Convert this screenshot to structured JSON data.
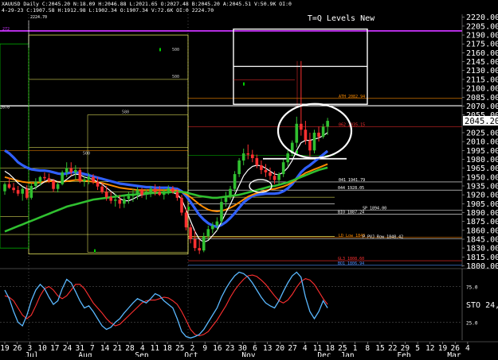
{
  "window": {
    "ticker_line": "XAUUSD Daily C:2045.20 N:18.09 H:2046.88 L:2021.65 O:2027.48 B:2045.20 A:2045.51 V:50.9K OI:0",
    "sub_line": "4-29-23 C:1907.58 H:1912.98 L:1902.34 O:1907.34 V:72.6K OI:0 2224.70",
    "tq_title": "T=Q Levels New"
  },
  "chart_data": [
    {
      "type": "candlestick",
      "title": "XAUUSD Daily",
      "annotation": "T=Q Levels New",
      "y_axis_side": "right",
      "ylim": [
        1798,
        2225
      ],
      "yticks": [
        2220,
        2205,
        2190,
        2175,
        2160,
        2145,
        2130,
        2115,
        2100,
        2085,
        2070,
        2055,
        2025,
        2010,
        1995,
        1980,
        1965,
        1950,
        1935,
        1920,
        1905,
        1890,
        1875,
        1860,
        1845,
        1830,
        1815,
        1800
      ],
      "last_price": "2045.20",
      "x_ticks": [
        "19",
        "26",
        "3",
        "10",
        "17",
        "24",
        "31",
        "7",
        "14",
        "21",
        "28",
        "4",
        "11",
        "18",
        "25",
        "2",
        "9",
        "16",
        "23",
        "30",
        "6",
        "13",
        "20",
        "27",
        "4",
        "11",
        "18",
        "25",
        "1",
        "8",
        "15",
        "22",
        "29",
        "5",
        "12",
        "19",
        "26",
        "4"
      ],
      "months": [
        "Jul",
        "Aug",
        "Sep",
        "Oct",
        "Nov",
        "Dec",
        "Jan",
        "Feb",
        "Mar"
      ],
      "levels": [
        {
          "label": "272",
          "value": 2197,
          "color": "#cc33ff"
        },
        {
          "label": "ATH 2082.94",
          "value": 2082.9,
          "color": "#ff8c00"
        },
        {
          "label": "062 2035.15",
          "value": 2035.15,
          "color": "#ff3030"
        },
        {
          "label": "",
          "value": 2070.5,
          "color": "#ffffff"
        },
        {
          "label": "",
          "value": 1981,
          "color": "#ffffff"
        },
        {
          "label": "",
          "value": 1987,
          "color": "#00c000"
        },
        {
          "label": "041 1941.79",
          "value": 1941.79,
          "color": "#ffffff"
        },
        {
          "label": "044 1928.05",
          "value": 1928.05,
          "color": "#ffffff"
        },
        {
          "label": "SP 1894.00",
          "value": 1894,
          "color": "#ffffff"
        },
        {
          "label": "BIO 1887.24",
          "value": 1887.24,
          "color": "#ffffff"
        },
        {
          "label": "LD Low 1848",
          "value": 1848,
          "color": "#ff8c00"
        },
        {
          "label": "P PVJ Row 1848.42",
          "value": 1846,
          "color": "#ffffff"
        },
        {
          "label": "GL3 1808.60",
          "value": 1808.6,
          "color": "#ff3030"
        },
        {
          "label": "BO1 1806.94",
          "value": 1801,
          "color": "#5090ff"
        }
      ],
      "boxes": [
        {
          "label": "500",
          "top": 2190,
          "bottom": 1820,
          "color": "#ffff66"
        },
        {
          "label": "580",
          "top": 2055,
          "bottom": 1823,
          "color": "#ffff66"
        }
      ],
      "target_box": {
        "top": 2200,
        "mid": 2137,
        "bottom": 2073,
        "color": "#ffffff"
      },
      "candles": [
        [
          1926,
          1941,
          1920,
          1938
        ],
        [
          1938,
          1949,
          1930,
          1932
        ],
        [
          1932,
          1940,
          1923,
          1928
        ],
        [
          1928,
          1935,
          1918,
          1922
        ],
        [
          1922,
          1934,
          1910,
          1930
        ],
        [
          1930,
          1936,
          1912,
          1915
        ],
        [
          1915,
          1940,
          1912,
          1935
        ],
        [
          1935,
          1948,
          1928,
          1942
        ],
        [
          1942,
          1952,
          1935,
          1950
        ],
        [
          1950,
          1958,
          1944,
          1948
        ],
        [
          1948,
          1956,
          1940,
          1944
        ],
        [
          1944,
          1947,
          1925,
          1930
        ],
        [
          1930,
          1942,
          1924,
          1938
        ],
        [
          1938,
          1961,
          1936,
          1958
        ],
        [
          1958,
          1975,
          1950,
          1965
        ],
        [
          1965,
          1975,
          1952,
          1958
        ],
        [
          1958,
          1970,
          1945,
          1962
        ],
        [
          1962,
          1966,
          1940,
          1943
        ],
        [
          1943,
          1952,
          1934,
          1946
        ],
        [
          1946,
          1957,
          1938,
          1950
        ],
        [
          1950,
          1955,
          1938,
          1942
        ],
        [
          1942,
          1950,
          1928,
          1934
        ],
        [
          1934,
          1940,
          1922,
          1925
        ],
        [
          1925,
          1935,
          1910,
          1916
        ],
        [
          1916,
          1925,
          1905,
          1910
        ],
        [
          1910,
          1922,
          1900,
          1912
        ],
        [
          1912,
          1920,
          1897,
          1905
        ],
        [
          1905,
          1918,
          1898,
          1913
        ],
        [
          1913,
          1925,
          1905,
          1918
        ],
        [
          1918,
          1930,
          1908,
          1922
        ],
        [
          1922,
          1933,
          1912,
          1928
        ],
        [
          1928,
          1932,
          1915,
          1920
        ],
        [
          1920,
          1929,
          1912,
          1925
        ],
        [
          1925,
          1935,
          1916,
          1930
        ],
        [
          1930,
          1938,
          1919,
          1925
        ],
        [
          1925,
          1935,
          1918,
          1920
        ],
        [
          1920,
          1930,
          1912,
          1926
        ],
        [
          1926,
          1936,
          1920,
          1931
        ],
        [
          1931,
          1935,
          1922,
          1925
        ],
        [
          1925,
          1930,
          1910,
          1915
        ],
        [
          1915,
          1920,
          1885,
          1890
        ],
        [
          1890,
          1898,
          1860,
          1865
        ],
        [
          1865,
          1870,
          1838,
          1845
        ],
        [
          1845,
          1860,
          1825,
          1830
        ],
        [
          1830,
          1845,
          1820,
          1826
        ],
        [
          1826,
          1856,
          1823,
          1850
        ],
        [
          1850,
          1868,
          1844,
          1862
        ],
        [
          1862,
          1874,
          1855,
          1868
        ],
        [
          1868,
          1882,
          1860,
          1875
        ],
        [
          1875,
          1914,
          1870,
          1908
        ],
        [
          1908,
          1925,
          1900,
          1918
        ],
        [
          1918,
          1935,
          1912,
          1930
        ],
        [
          1930,
          1960,
          1925,
          1955
        ],
        [
          1955,
          1982,
          1950,
          1978
        ],
        [
          1978,
          1998,
          1970,
          1990
        ],
        [
          1990,
          2005,
          1980,
          1988
        ],
        [
          1988,
          1996,
          1975,
          1982
        ],
        [
          1982,
          1988,
          1965,
          1970
        ],
        [
          1970,
          1978,
          1955,
          1962
        ],
        [
          1962,
          1972,
          1950,
          1958
        ],
        [
          1958,
          1966,
          1945,
          1952
        ],
        [
          1952,
          1960,
          1938,
          1945
        ],
        [
          1945,
          1958,
          1938,
          1955
        ],
        [
          1955,
          1980,
          1950,
          1975
        ],
        [
          1975,
          1995,
          1968,
          1990
        ],
        [
          1990,
          2012,
          1985,
          2008
        ],
        [
          2008,
          2052,
          2000,
          2040
        ],
        [
          2040,
          2146,
          2020,
          2030
        ],
        [
          2030,
          2045,
          2005,
          2012
        ],
        [
          2012,
          2025,
          1985,
          1995
        ],
        [
          1995,
          2030,
          1990,
          2025
        ],
        [
          2025,
          2035,
          2010,
          2018
        ],
        [
          2018,
          2040,
          2015,
          2035
        ],
        [
          2035,
          2050,
          2021,
          2045
        ]
      ],
      "series": [
        {
          "name": "",
          "color": "#3060ff",
          "values": [
            1995,
            1990,
            1983,
            1975,
            1970,
            1966,
            1963,
            1962,
            1961,
            1961,
            1960,
            1958,
            1956,
            1955,
            1956,
            1958,
            1958,
            1957,
            1955,
            1953,
            1951,
            1949,
            1947,
            1945,
            1943,
            1941,
            1939,
            1938,
            1937,
            1936,
            1935,
            1934,
            1933,
            1933,
            1932,
            1932,
            1932,
            1932,
            1931,
            1930,
            1926,
            1918,
            1908,
            1897,
            1886,
            1878,
            1872,
            1868,
            1866,
            1869,
            1874,
            1881,
            1889,
            1898,
            1907,
            1913,
            1918,
            1920,
            1921,
            1922,
            1922,
            1922,
            1923,
            1926,
            1931,
            1938,
            1948,
            1958,
            1965,
            1970,
            1976,
            1982,
            1988,
            1994
          ]
        },
        {
          "name": "",
          "color": "#ff8c00",
          "values": [
            1950,
            1948,
            1946,
            1944,
            1942,
            1941,
            1940,
            1940,
            1941,
            1942,
            1943,
            1943,
            1942,
            1942,
            1943,
            1944,
            1945,
            1945,
            1944,
            1943,
            1942,
            1941,
            1940,
            1938,
            1936,
            1934,
            1932,
            1931,
            1930,
            1929,
            1928,
            1928,
            1928,
            1928,
            1928,
            1928,
            1928,
            1928,
            1928,
            1927,
            1925,
            1921,
            1916,
            1910,
            1904,
            1899,
            1895,
            1893,
            1892,
            1893,
            1895,
            1898,
            1902,
            1907,
            1912,
            1917,
            1920,
            1923,
            1925,
            1927,
            1929,
            1930,
            1932,
            1934,
            1937,
            1941,
            1946,
            1952,
            1957,
            1960,
            1963,
            1966,
            1969,
            1972
          ]
        },
        {
          "name": "",
          "color": "#ffffff",
          "values": [
            1960,
            1955,
            1948,
            1940,
            1934,
            1930,
            1929,
            1932,
            1937,
            1942,
            1946,
            1945,
            1942,
            1941,
            1946,
            1952,
            1955,
            1954,
            1950,
            1948,
            1946,
            1942,
            1938,
            1932,
            1926,
            1920,
            1914,
            1910,
            1910,
            1913,
            1917,
            1920,
            1921,
            1922,
            1924,
            1924,
            1923,
            1924,
            1924,
            1921,
            1912,
            1895,
            1876,
            1858,
            1845,
            1840,
            1843,
            1851,
            1860,
            1874,
            1890,
            1904,
            1920,
            1936,
            1952,
            1962,
            1968,
            1970,
            1969,
            1965,
            1960,
            1955,
            1954,
            1958,
            1966,
            1978,
            1995,
            2008,
            2012,
            2012,
            2014,
            2016,
            2020,
            2025
          ]
        },
        {
          "name": "",
          "color": "#30c030",
          "values": [
            1858,
            1861,
            1864,
            1867,
            1870,
            1873,
            1876,
            1879,
            1882,
            1885,
            1888,
            1891,
            1894,
            1897,
            1900,
            1902,
            1904,
            1906,
            1908,
            1910,
            1912,
            1913,
            1914,
            1915,
            1916,
            1917,
            1918,
            1919,
            1920,
            1920,
            1921,
            1922,
            1922,
            1923,
            1923,
            1924,
            1924,
            1924,
            1925,
            1925,
            1925,
            1924,
            1922,
            1920,
            1918,
            1917,
            1916,
            1915,
            1915,
            1916,
            1917,
            1918,
            1919,
            1920,
            1922,
            1924,
            1926,
            1928,
            1930,
            1932,
            1934,
            1935,
            1937,
            1939,
            1941,
            1944,
            1947,
            1950,
            1953,
            1956,
            1959,
            1962,
            1964,
            1966
          ]
        }
      ],
      "oscillator": {
        "label": "STO 24,",
        "ticks": [
          "75.0",
          "25.0"
        ],
        "k": [
          70,
          58,
          40,
          25,
          20,
          35,
          55,
          70,
          78,
          72,
          60,
          50,
          55,
          72,
          85,
          80,
          68,
          55,
          45,
          48,
          40,
          30,
          20,
          15,
          18,
          25,
          30,
          38,
          45,
          52,
          58,
          55,
          52,
          58,
          65,
          62,
          55,
          50,
          45,
          30,
          12,
          5,
          3,
          5,
          8,
          15,
          25,
          35,
          45,
          60,
          72,
          82,
          90,
          95,
          93,
          88,
          80,
          70,
          60,
          52,
          48,
          45,
          55,
          68,
          80,
          90,
          95,
          88,
          60,
          40,
          30,
          40,
          55,
          45
        ],
        "d": [
          62,
          60,
          55,
          45,
          35,
          30,
          35,
          48,
          62,
          72,
          75,
          70,
          62,
          58,
          62,
          70,
          78,
          78,
          72,
          62,
          52,
          45,
          38,
          30,
          24,
          20,
          22,
          28,
          34,
          40,
          46,
          52,
          55,
          56,
          56,
          58,
          60,
          59,
          55,
          50,
          40,
          28,
          15,
          8,
          6,
          8,
          12,
          20,
          28,
          38,
          48,
          60,
          70,
          78,
          85,
          90,
          91,
          89,
          84,
          78,
          70,
          62,
          55,
          52,
          56,
          64,
          74,
          82,
          86,
          84,
          78,
          68,
          58,
          50
        ]
      }
    }
  ]
}
